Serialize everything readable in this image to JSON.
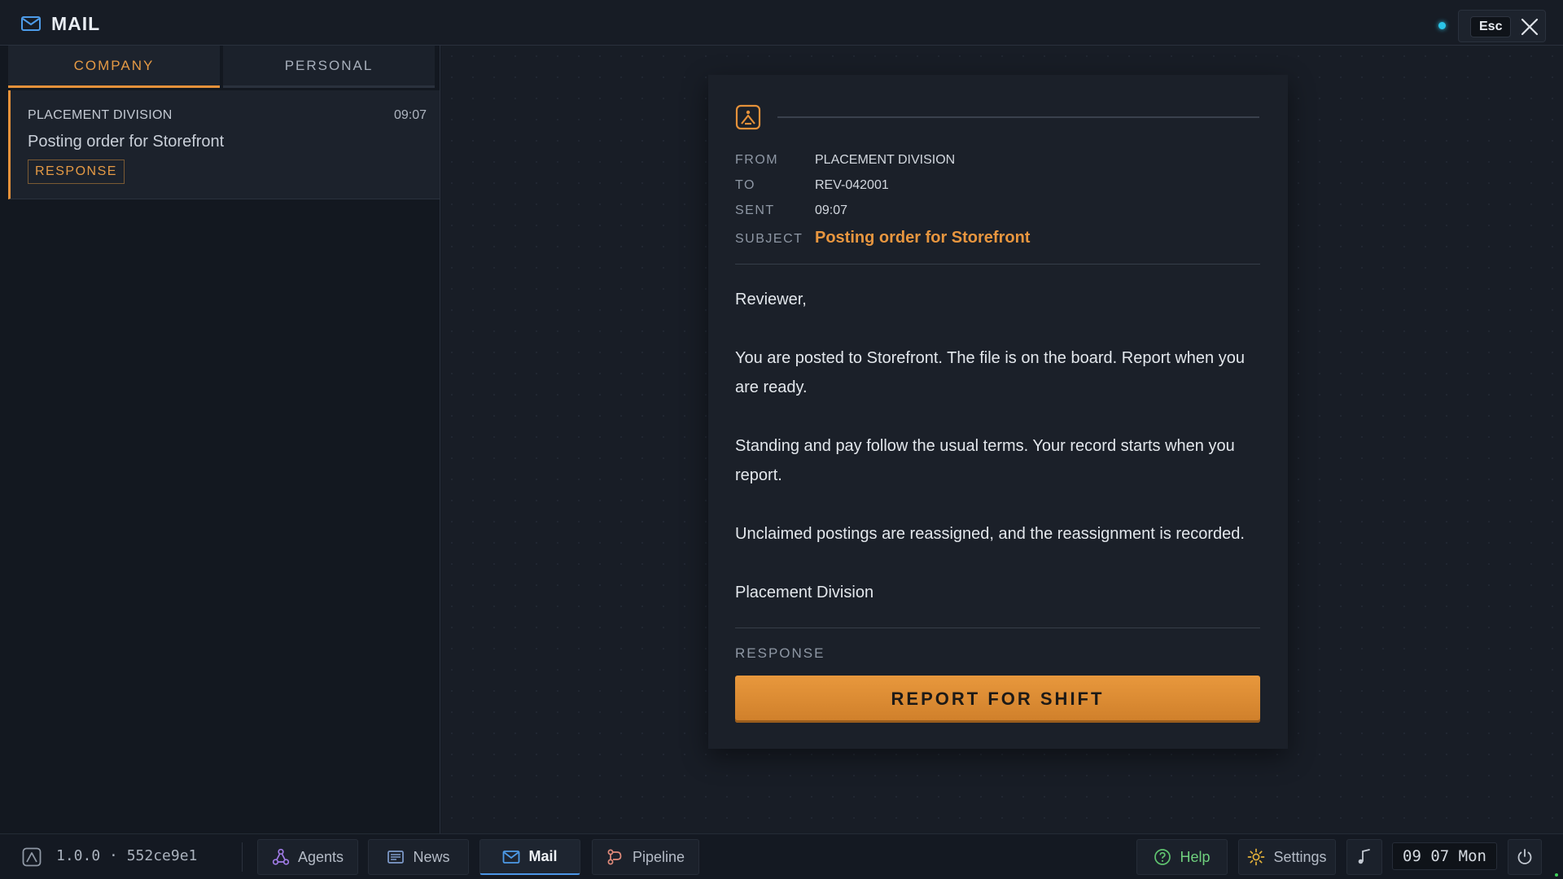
{
  "window": {
    "title": "MAIL",
    "esc_label": "Esc",
    "accent_color": "#e5913a",
    "status_color": "#2bc5e8"
  },
  "inbox": {
    "tabs": [
      {
        "label": "COMPANY",
        "active": true
      },
      {
        "label": "PERSONAL",
        "active": false
      }
    ],
    "items": [
      {
        "sender": "PLACEMENT DIVISION",
        "time": "09:07",
        "subject": "Posting order for Storefront",
        "badge": "RESPONSE"
      }
    ]
  },
  "message": {
    "from_label": "FROM",
    "from": "PLACEMENT DIVISION",
    "to_label": "TO",
    "to": "REV-042001",
    "sent_label": "SENT",
    "sent": "09:07",
    "subject_label": "SUBJECT",
    "subject": "Posting order for Storefront",
    "body": [
      "Reviewer,",
      "You are posted to Storefront. The file is on the board. Report when you are ready.",
      "Standing and pay follow the usual terms. Your record starts when you report.",
      "Unclaimed postings are reassigned, and the reassignment is recorded.",
      "Placement Division"
    ],
    "response_label": "RESPONSE",
    "response_button": "REPORT FOR SHIFT"
  },
  "taskbar": {
    "version": "1.0.0 · 552ce9e1",
    "apps": [
      {
        "label": "Agents",
        "icon": "agents-icon"
      },
      {
        "label": "News",
        "icon": "news-icon"
      },
      {
        "label": "Mail",
        "icon": "mail-icon",
        "active": true
      },
      {
        "label": "Pipeline",
        "icon": "pipeline-icon"
      }
    ],
    "help_label": "Help",
    "settings_label": "Settings",
    "clock": "09 07 Mon"
  }
}
